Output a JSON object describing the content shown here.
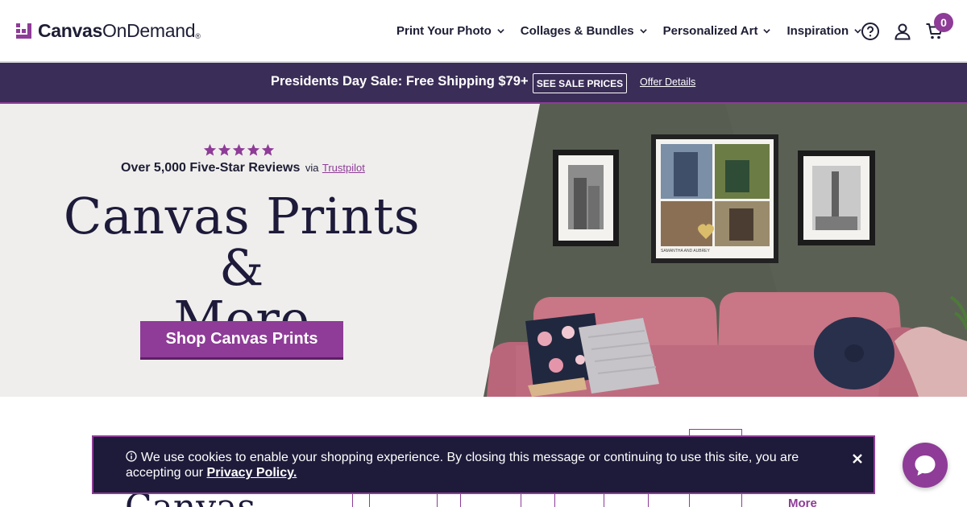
{
  "header": {
    "logo": {
      "word1": "Canvas",
      "word2": "On",
      "word3": "Demand",
      "mark": "®"
    },
    "nav": [
      {
        "label": "Print Your Photo"
      },
      {
        "label": "Collages & Bundles"
      },
      {
        "label": "Personalized Art"
      },
      {
        "label": "Inspiration"
      }
    ],
    "icons": [
      "help-icon",
      "account-icon",
      "cart-icon"
    ],
    "cart_count": "0"
  },
  "promo": {
    "text": "Presidents Day Sale: Free Shipping $79+",
    "button": "SEE SALE PRICES",
    "link": "Offer Details"
  },
  "hero": {
    "rating_stars": 5,
    "reviews_text": "Over 5,000 Five-Star Reviews",
    "via": "via",
    "trustpilot": "Trustpilot",
    "title_line1": "Canvas Prints &",
    "title_line2": "More",
    "cta": "Shop Canvas Prints",
    "collage_caption": "SAMANTHA AND AUBREY"
  },
  "lower": {
    "title_partial": "Canvas",
    "more_partial": "More"
  },
  "cookie": {
    "text": "We use cookies to enable your shopping experience. By closing this message or continuing to use this site, you are accepting our",
    "link": "Privacy Policy."
  },
  "colors": {
    "brand_purple": "#8e3c97",
    "promo_bg": "#3a2d57",
    "navy": "#1d1a3a"
  }
}
